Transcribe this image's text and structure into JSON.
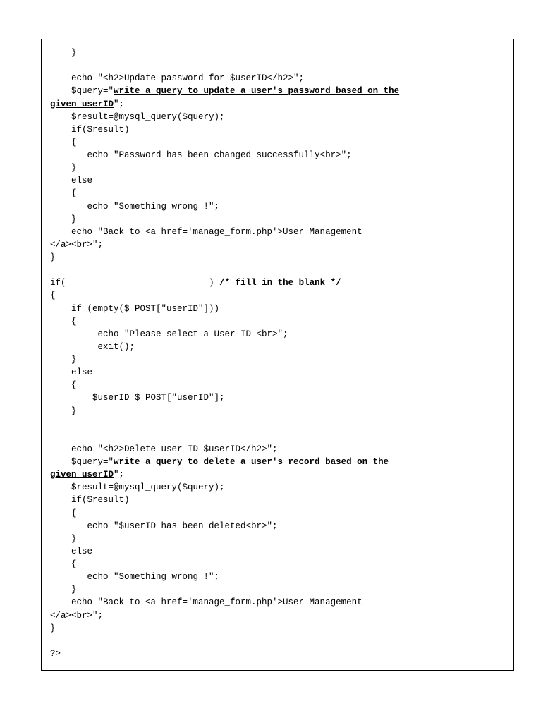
{
  "code": {
    "l01": "    }",
    "l02": "",
    "l03": "    echo \"<h2>Update password for $userID</h2>\";",
    "l04a": "    $query=\"",
    "l04b": "write a query to update a user's password based on the",
    "l04c": "given userID",
    "l04d": "\";",
    "l05": "    $result=@mysql_query($query);",
    "l06": "    if($result)",
    "l07": "    {",
    "l08": "       echo \"Password has been changed successfully<br>\";",
    "l09": "    }",
    "l10": "    else",
    "l11": "    {",
    "l12": "       echo \"Something wrong !\";",
    "l13": "    }",
    "l14": "    echo \"Back to <a href='manage_form.php'>User Management",
    "l15": "</a><br>\";",
    "l16": "}",
    "l17": "",
    "l18a": "if(",
    "l18b": "                           ",
    "l18c": ") ",
    "l18d": "/* fill in the blank */",
    "l19": "{",
    "l20": "    if (empty($_POST[\"userID\"]))",
    "l21": "    {",
    "l22": "         echo \"Please select a User ID <br>\";",
    "l23": "         exit();",
    "l24": "    }",
    "l25": "    else",
    "l26": "    {",
    "l27": "        $userID=$_POST[\"userID\"];",
    "l28": "    }",
    "l29": "",
    "l30": "",
    "l31": "    echo \"<h2>Delete user ID $userID</h2>\";",
    "l32a": "    $query=\"",
    "l32b": "write a query to delete a user's record based on the",
    "l32c": "given userID",
    "l32d": "\";",
    "l33": "    $result=@mysql_query($query);",
    "l34": "    if($result)",
    "l35": "    {",
    "l36": "       echo \"$userID has been deleted<br>\";",
    "l37": "    }",
    "l38": "    else",
    "l39": "    {",
    "l40": "       echo \"Something wrong !\";",
    "l41": "    }",
    "l42": "    echo \"Back to <a href='manage_form.php'>User Management",
    "l43": "</a><br>\";",
    "l44": "}",
    "l45": "",
    "l46": "?>"
  }
}
